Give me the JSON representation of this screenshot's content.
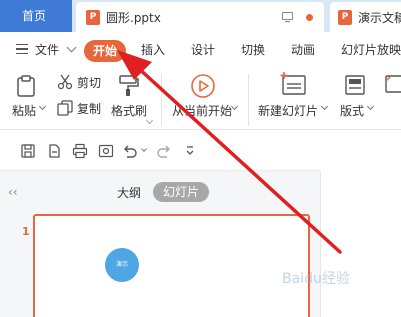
{
  "tabs": {
    "home": "首页",
    "doc": "圆形.pptx",
    "doc2": "演示文稿"
  },
  "menu": {
    "file": "文件",
    "start": "开始",
    "items": [
      "插入",
      "设计",
      "切换",
      "动画",
      "幻灯片放映"
    ]
  },
  "ribbon": {
    "paste": "粘贴",
    "cut": "剪切",
    "copy": "复制",
    "format_painter": "格式刷",
    "from_current": "从当前开始",
    "new_slide": "新建幻灯片",
    "layout": "版式"
  },
  "pane": {
    "outline": "大纲",
    "slides": "幻灯片",
    "slide_number": "1",
    "circle_text": "演示"
  },
  "watermark": "Baidu经验",
  "colors": {
    "accent": "#e8663c",
    "home_tab": "#3f7ad6",
    "arrow": "#e02020"
  }
}
